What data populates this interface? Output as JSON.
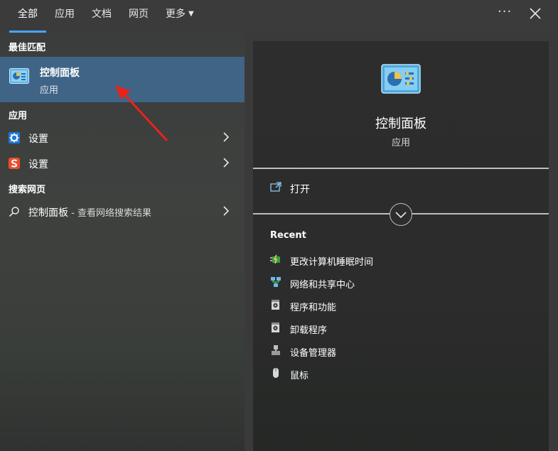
{
  "tabs": [
    {
      "label": "全部",
      "active": true
    },
    {
      "label": "应用"
    },
    {
      "label": "文档"
    },
    {
      "label": "网页"
    },
    {
      "label": "更多"
    }
  ],
  "header": {
    "more_options": "···"
  },
  "left": {
    "best_match_heading": "最佳匹配",
    "best_match": {
      "title": "控制面板",
      "subtitle": "应用",
      "icon": "control-panel-icon"
    },
    "apps_heading": "应用",
    "apps": [
      {
        "label": "设置",
        "icon": "gear-icon",
        "icon_color": "#1e90ff"
      },
      {
        "label": "设置",
        "icon": "sogou-s-icon",
        "icon_color": "#e8502a"
      }
    ],
    "web_heading": "搜索网页",
    "web": {
      "query": "控制面板",
      "suffix": " - 查看网络搜索结果",
      "icon": "search-icon"
    }
  },
  "right": {
    "title": "控制面板",
    "subtitle": "应用",
    "open_label": "打开",
    "recent_heading": "Recent",
    "recent": [
      {
        "label": "更改计算机睡眠时间",
        "icon": "power-options-icon"
      },
      {
        "label": "网络和共享中心",
        "icon": "network-icon"
      },
      {
        "label": "程序和功能",
        "icon": "programs-icon"
      },
      {
        "label": "卸载程序",
        "icon": "uninstall-icon"
      },
      {
        "label": "设备管理器",
        "icon": "device-manager-icon"
      },
      {
        "label": "鼠标",
        "icon": "mouse-icon"
      }
    ]
  },
  "colors": {
    "accent": "#4aa3ff",
    "selection": "#3f6485",
    "annotation_arrow": "#e8231c"
  }
}
